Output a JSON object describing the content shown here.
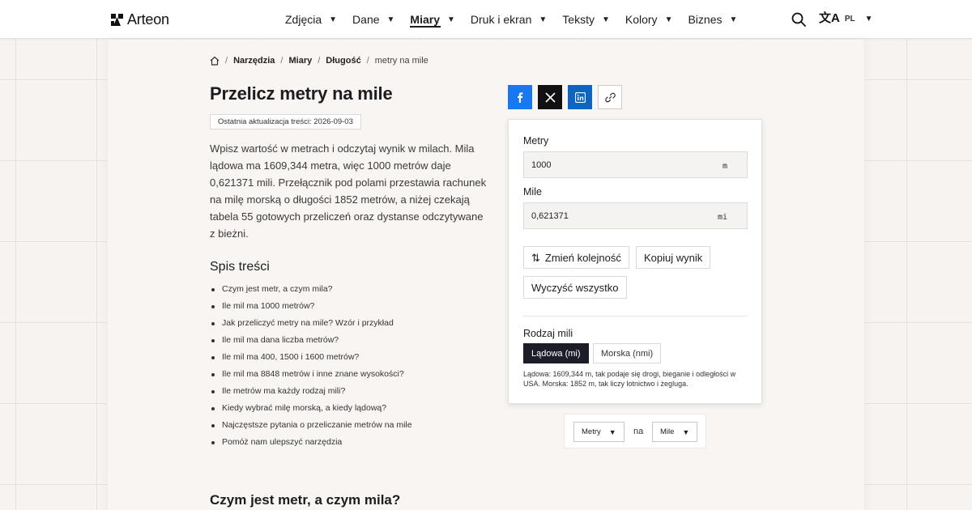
{
  "header": {
    "logo_text": "Arteon",
    "nav": [
      {
        "label": "Zdjęcia"
      },
      {
        "label": "Dane"
      },
      {
        "label": "Miary",
        "active": true
      },
      {
        "label": "Druk i ekran"
      },
      {
        "label": "Teksty"
      },
      {
        "label": "Kolory"
      },
      {
        "label": "Biznes"
      }
    ],
    "caret": "▼",
    "lang_icon": "文A",
    "lang_code": "PL"
  },
  "breadcrumb": {
    "items": [
      "Narzędzia",
      "Miary",
      "Długość"
    ],
    "current": "metry na mile",
    "separator": "/"
  },
  "page": {
    "title": "Przelicz metry na mile",
    "updated": "Ostatnia aktualizacja treści: 2026-09-03",
    "intro": "Wpisz wartość w metrach i odczytaj wynik w milach. Mila lądowa ma 1609,344 metra, więc 1000 metrów daje 0,621371 mili. Przełącznik pod polami przestawia rachunek na milę morską o długości 1852 metrów, a niżej czekają tabela 55 gotowych przeliczeń oraz dystanse odczytywane z bieżni.",
    "toc_title": "Spis treści",
    "toc": [
      "Czym jest metr, a czym mila?",
      "Ile mil ma 1000 metrów?",
      "Jak przeliczyć metry na mile? Wzór i przykład",
      "Ile mil ma dana liczba metrów?",
      "Ile mil ma 400, 1500 i 1600 metrów?",
      "Ile mil ma 8848 metrów i inne znane wysokości?",
      "Ile metrów ma każdy rodzaj mili?",
      "Kiedy wybrać milę morską, a kiedy lądową?",
      "Najczęstsze pytania o przeliczanie metrów na mile",
      "Pomóż nam ulepszyć narzędzia"
    ],
    "section_title": "Czym jest metr, a czym mila?"
  },
  "share": {
    "icons": [
      "facebook-icon",
      "x-icon",
      "linkedin-icon",
      "link-icon"
    ],
    "colors": {
      "facebook": "#1877f2",
      "x": "#111111",
      "linkedin": "#0a66c2"
    }
  },
  "converter": {
    "from_label": "Metry",
    "from_value": "1000",
    "from_unit": "m",
    "to_label": "Mile",
    "to_value": "0,621371",
    "to_unit": "mi",
    "swap_icon": "⇅",
    "swap_label": "Zmień kolejność",
    "copy_label": "Kopiuj wynik",
    "clear_label": "Wyczyść wszystko",
    "mile_type_label": "Rodzaj mili",
    "mile_land": "Lądowa (mi)",
    "mile_nautical": "Morska (nmi)",
    "mile_selected": "Lądowa (mi)",
    "mile_note": "Lądowa: 1609,344 m, tak podaje się drogi, bieganie i odległości w USA. Morska: 1852 m, tak liczy lotnictwo i żegluga."
  },
  "unit_selector": {
    "from": "Metry",
    "word": "na",
    "to": "Mile"
  }
}
